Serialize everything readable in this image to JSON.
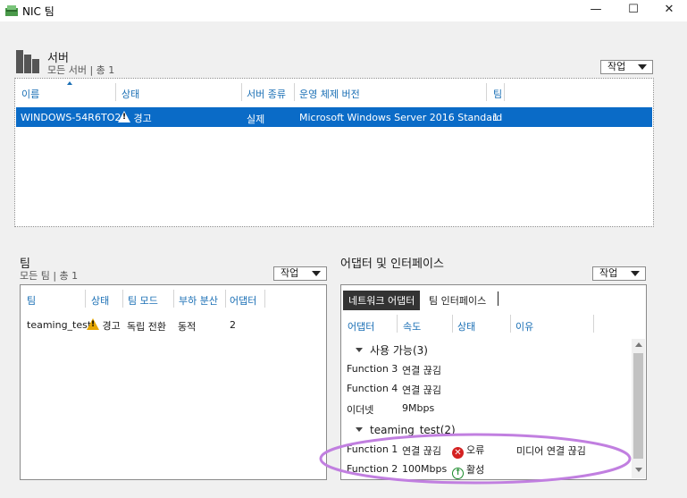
{
  "window": {
    "title": "NIC 팀",
    "minimize": "—",
    "maximize": "☐",
    "close": "✕"
  },
  "servers": {
    "title": "서버",
    "subtitle": "모든 서버 | 총 1",
    "tasks_label": "작업",
    "columns": [
      "이름",
      "상태",
      "서버 종류",
      "운영 체제 버전",
      "팀"
    ],
    "rows": [
      {
        "name": "WINDOWS-54R6TO2",
        "status": "경고",
        "type": "실제",
        "os": "Microsoft Windows Server 2016 Standard",
        "teams": "1"
      }
    ]
  },
  "teams": {
    "title": "팀",
    "subtitle": "모든 팀 | 총 1",
    "tasks_label": "작업",
    "columns": [
      "팀",
      "상태",
      "팀 모드",
      "부하 분산",
      "어댑터"
    ],
    "rows": [
      {
        "team": "teaming_test",
        "status": "경고",
        "mode": "독립 전환",
        "lb": "동적",
        "adapters": "2"
      }
    ]
  },
  "adapters": {
    "title": "어댑터 및 인터페이스",
    "tasks_label": "작업",
    "tabs": [
      "네트워크 어댑터",
      "팀 인터페이스"
    ],
    "columns": [
      "어댑터",
      "속도",
      "상태",
      "이유"
    ],
    "groups": [
      {
        "label": "사용 가능(3)",
        "rows": [
          {
            "adapter": "Function 3",
            "speed": "연결 끊김",
            "state": "",
            "reason": ""
          },
          {
            "adapter": "Function 4",
            "speed": "연결 끊김",
            "state": "",
            "reason": ""
          },
          {
            "adapter": "이더넷",
            "speed": "9Mbps",
            "state": "",
            "reason": ""
          }
        ]
      },
      {
        "label": "teaming_test(2)",
        "rows": [
          {
            "adapter": "Function 1",
            "speed": "연결 끊김",
            "state": "오류",
            "reason": "미디어 연결 끊김"
          },
          {
            "adapter": "Function 2",
            "speed": "100Mbps",
            "state": "활성",
            "reason": ""
          }
        ]
      }
    ]
  },
  "colors": {
    "header_text": "#1a6fb5",
    "selection": "#0a6bc7",
    "warning": "#e6a700",
    "error": "#d42222",
    "ok": "#1a8a2a",
    "highlight_ellipse": "#c17fe0"
  }
}
